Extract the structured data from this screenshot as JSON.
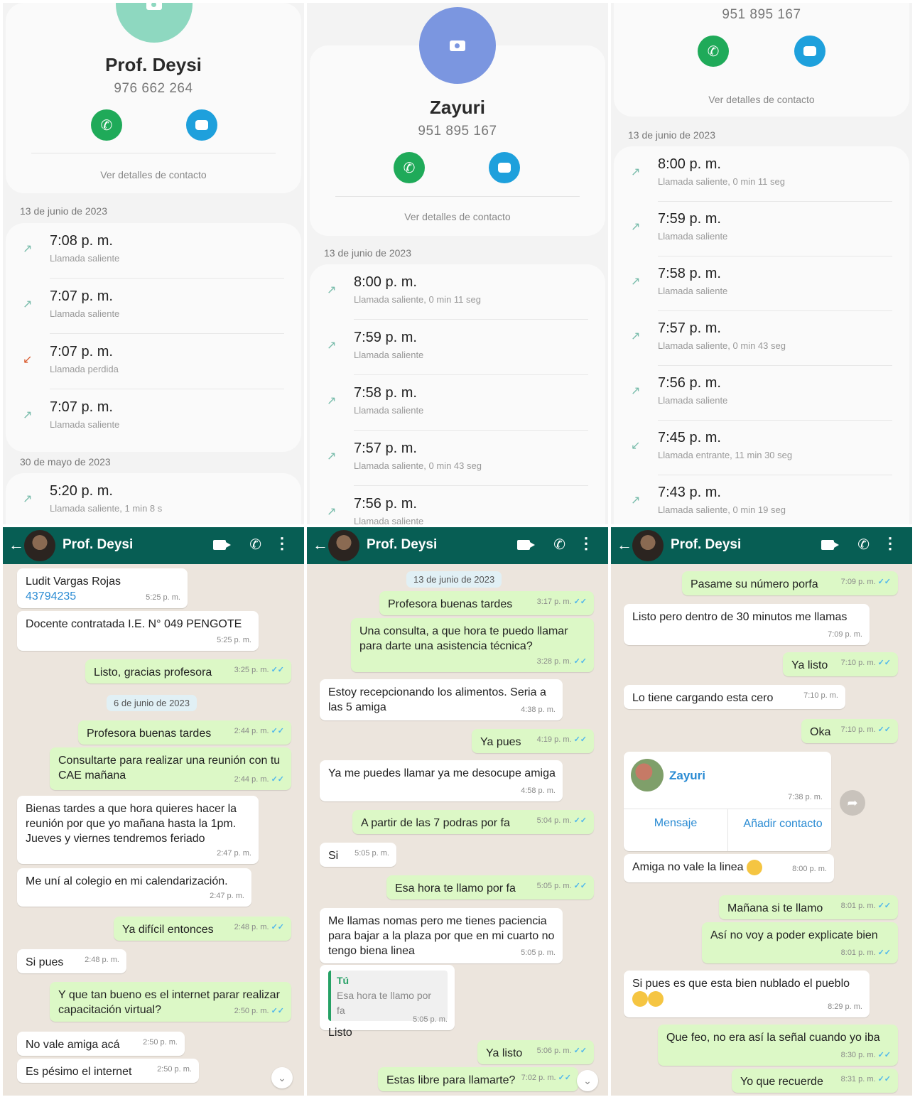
{
  "logs": [
    {
      "name": "Prof. Deysi",
      "number": "976 662 264",
      "details": "Ver detalles de contacto",
      "groups": [
        {
          "date": "13 de junio de 2023",
          "calls": [
            {
              "time": "7:08 p. m.",
              "type": "Llamada saliente",
              "icon": "outgoing"
            },
            {
              "time": "7:07 p. m.",
              "type": "Llamada saliente",
              "icon": "outgoing"
            },
            {
              "time": "7:07 p. m.",
              "type": "Llamada perdida",
              "icon": "missed"
            },
            {
              "time": "7:07 p. m.",
              "type": "Llamada saliente",
              "icon": "outgoing"
            }
          ]
        },
        {
          "date": "30 de mayo de 2023",
          "calls": [
            {
              "time": "5:20 p. m.",
              "type": "Llamada saliente, 1 min 8 s",
              "icon": "outgoing"
            }
          ]
        }
      ]
    },
    {
      "name": "Zayuri",
      "number": "951 895 167",
      "details": "Ver detalles de contacto",
      "groups": [
        {
          "date": "13 de junio de 2023",
          "calls": [
            {
              "time": "8:00 p. m.",
              "type": "Llamada saliente, 0 min 11 seg",
              "icon": "outgoing"
            },
            {
              "time": "7:59 p. m.",
              "type": "Llamada saliente",
              "icon": "outgoing"
            },
            {
              "time": "7:58 p. m.",
              "type": "Llamada saliente",
              "icon": "outgoing"
            },
            {
              "time": "7:57 p. m.",
              "type": "Llamada saliente, 0 min 43 seg",
              "icon": "outgoing"
            },
            {
              "time": "7:56 p. m.",
              "type": "Llamada saliente",
              "icon": "outgoing"
            }
          ]
        }
      ]
    },
    {
      "number": "951 895 167",
      "details": "Ver detalles de contacto",
      "groups": [
        {
          "date": "13 de junio de 2023",
          "calls": [
            {
              "time": "8:00 p. m.",
              "type": "Llamada saliente, 0 min 11 seg",
              "icon": "outgoing"
            },
            {
              "time": "7:59 p. m.",
              "type": "Llamada saliente",
              "icon": "outgoing"
            },
            {
              "time": "7:58 p. m.",
              "type": "Llamada saliente",
              "icon": "outgoing"
            },
            {
              "time": "7:57 p. m.",
              "type": "Llamada saliente, 0 min 43 seg",
              "icon": "outgoing"
            },
            {
              "time": "7:56 p. m.",
              "type": "Llamada saliente",
              "icon": "outgoing"
            },
            {
              "time": "7:45 p. m.",
              "type": "Llamada entrante, 11 min 30 seg",
              "icon": "incoming"
            },
            {
              "time": "7:43 p. m.",
              "type": "Llamada saliente, 0 min 19 seg",
              "icon": "outgoing"
            }
          ]
        }
      ]
    }
  ],
  "chats": [
    {
      "title": "Prof. Deysi",
      "messages": [
        {
          "dir": "in",
          "name": "Ludit Vargas Rojas",
          "link": "43794235",
          "time": "5:25 p. m."
        },
        {
          "dir": "in",
          "text": "Docente contratada I.E. N° 049 PENGOTE",
          "time": "5:25 p. m."
        },
        {
          "dir": "out",
          "text": "Listo, gracias profesora",
          "time": "3:25 p. m."
        },
        {
          "dir": "date",
          "text": "6 de junio de 2023"
        },
        {
          "dir": "out",
          "text": "Profesora buenas tardes",
          "time": "2:44 p. m."
        },
        {
          "dir": "out",
          "text": "Consultarte para realizar una reunión con tu CAE mañana",
          "time": "2:44 p. m."
        },
        {
          "dir": "in",
          "text": "Bienas tardes a que hora quieres hacer la reunión por que yo mañana hasta la 1pm. Jueves y viernes tendremos feriado",
          "time": "2:47 p. m."
        },
        {
          "dir": "in",
          "text": "Me uní al colegio en mi calendarización.",
          "time": "2:47 p. m."
        },
        {
          "dir": "out",
          "text": "Ya difícil entonces",
          "time": "2:48 p. m."
        },
        {
          "dir": "in",
          "text": "Si pues",
          "time": "2:48 p. m."
        },
        {
          "dir": "out",
          "text": "Y que tan bueno es el internet parar realizar capacitación virtual?",
          "time": "2:50 p. m."
        },
        {
          "dir": "in",
          "text": "No vale amiga acá",
          "time": "2:50 p. m."
        },
        {
          "dir": "in",
          "text": "Es pésimo el internet",
          "time": "2:50 p. m."
        }
      ]
    },
    {
      "title": "Prof. Deysi",
      "messages": [
        {
          "dir": "date",
          "text": "13 de junio de 2023"
        },
        {
          "dir": "out",
          "text": "Profesora buenas tardes",
          "time": "3:17 p. m."
        },
        {
          "dir": "out",
          "text": "Una consulta, a que hora te puedo llamar para darte una asistencia técnica?",
          "time": "3:28 p. m."
        },
        {
          "dir": "in",
          "text": "Estoy recepcionando los alimentos. Seria a las 5 amiga",
          "time": "4:38 p. m."
        },
        {
          "dir": "out",
          "text": "Ya pues",
          "time": "4:19 p. m."
        },
        {
          "dir": "in",
          "text": "Ya me puedes llamar ya me desocupe amiga",
          "time": "4:58 p. m."
        },
        {
          "dir": "out",
          "text": "A partir de las 7 podras por fa",
          "time": "5:04 p. m."
        },
        {
          "dir": "in",
          "text": "Si",
          "time": "5:05 p. m."
        },
        {
          "dir": "out",
          "text": "Esa hora te llamo por fa",
          "time": "5:05 p. m."
        },
        {
          "dir": "in",
          "text": "Me llamas nomas pero me tienes paciencia para bajar a la plaza por que en mi cuarto no tengo biena linea",
          "time": "5:05 p. m."
        },
        {
          "dir": "in",
          "quote_author": "Tú",
          "quote_text": "Esa hora te llamo por fa",
          "text": "Listo",
          "time": "5:05 p. m."
        },
        {
          "dir": "out",
          "text": "Ya listo",
          "time": "5:06 p. m."
        },
        {
          "dir": "out",
          "text": "Estas libre para llamarte?",
          "time": "7:02 p. m."
        }
      ]
    },
    {
      "title": "Prof. Deysi",
      "messages": [
        {
          "dir": "out",
          "text": "Pasame su número porfa",
          "time": "7:09 p. m."
        },
        {
          "dir": "in",
          "text": "Listo pero dentro de 30 minutos me llamas",
          "time": "7:09 p. m."
        },
        {
          "dir": "out",
          "text": "Ya listo",
          "time": "7:10 p. m."
        },
        {
          "dir": "in",
          "text": "Lo tiene cargando esta cero",
          "time": "7:10 p. m."
        },
        {
          "dir": "out",
          "text": "Oka",
          "time": "7:10 p. m."
        },
        {
          "dir": "contact",
          "name": "Zayuri",
          "time": "7:38 p. m.",
          "btn1": "Mensaje",
          "btn2": "Añadir contacto"
        },
        {
          "dir": "in",
          "text": "Amiga no vale la linea",
          "time": "8:00 p. m."
        },
        {
          "dir": "out",
          "text": "Mañana si te llamo",
          "time": "8:01 p. m."
        },
        {
          "dir": "out",
          "text": "Así no voy a poder explicate bien",
          "time": "8:01 p. m."
        },
        {
          "dir": "in",
          "text": "Si pues es que esta bien nublado el pueblo",
          "time": "8:29 p. m."
        },
        {
          "dir": "out",
          "text": "Que feo, no era así la señal cuando yo iba",
          "time": "8:30 p. m."
        },
        {
          "dir": "out",
          "text": "Yo que recuerde",
          "time": "8:31 p. m."
        }
      ]
    }
  ]
}
